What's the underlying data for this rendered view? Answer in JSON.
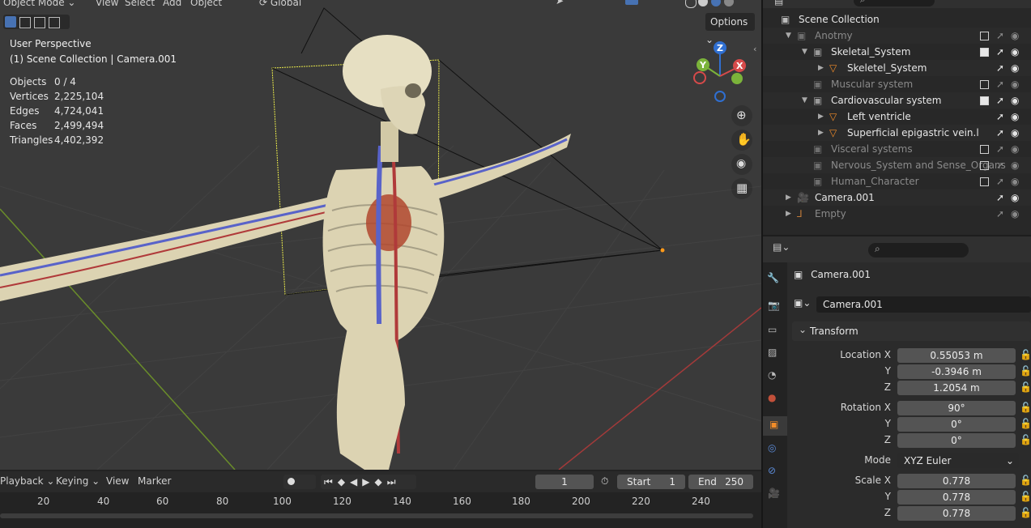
{
  "viewport": {
    "header": {
      "mode_label": "Object Mode",
      "menus": [
        "View",
        "Select",
        "Add",
        "Object"
      ],
      "orientation": "Global",
      "options_label": "Options"
    },
    "overlay": {
      "perspective": "User Perspective",
      "context": "(1) Scene Collection | Camera.001"
    },
    "stats": [
      {
        "label": "Objects",
        "value": "0 / 4"
      },
      {
        "label": "Vertices",
        "value": "2,225,104"
      },
      {
        "label": "Edges",
        "value": "4,724,041"
      },
      {
        "label": "Faces",
        "value": "2,499,494"
      },
      {
        "label": "Triangles",
        "value": "4,402,392"
      }
    ],
    "gizmo": {
      "z": "Z",
      "y": "Y",
      "x": "X"
    }
  },
  "timeline": {
    "menus": {
      "playback": "Playback",
      "keying": "Keying",
      "view": "View",
      "marker": "Marker"
    },
    "current_frame": "1",
    "start_label": "Start",
    "start_value": "1",
    "end_label": "End",
    "end_value": "250",
    "ruler": [
      "20",
      "40",
      "60",
      "80",
      "100",
      "120",
      "140",
      "160",
      "180",
      "200",
      "220",
      "240"
    ]
  },
  "outliner": {
    "root": "Scene Collection",
    "rows": [
      {
        "name": "Anotmy",
        "indent": 1,
        "expanded": true,
        "kind": "collection",
        "dim": true
      },
      {
        "name": "Skeletal_System",
        "indent": 2,
        "expanded": true,
        "kind": "collection",
        "dim": false
      },
      {
        "name": "Skeletel_System",
        "indent": 3,
        "expanded": false,
        "kind": "mesh",
        "dim": false
      },
      {
        "name": "Muscular system",
        "indent": 2,
        "expanded": null,
        "kind": "collection",
        "dim": true
      },
      {
        "name": "Cardiovascular system",
        "indent": 2,
        "expanded": true,
        "kind": "collection",
        "dim": false
      },
      {
        "name": "Left ventricle",
        "indent": 3,
        "expanded": false,
        "kind": "mesh",
        "dim": false
      },
      {
        "name": "Superficial epigastric vein.l",
        "indent": 3,
        "expanded": false,
        "kind": "mesh",
        "dim": false
      },
      {
        "name": "Visceral systems",
        "indent": 2,
        "expanded": null,
        "kind": "collection",
        "dim": true
      },
      {
        "name": "Nervous_System and Sense_Organs",
        "indent": 2,
        "expanded": null,
        "kind": "collection",
        "dim": true
      },
      {
        "name": "Human_Character",
        "indent": 2,
        "expanded": null,
        "kind": "collection",
        "dim": true
      },
      {
        "name": "Camera.001",
        "indent": 1,
        "expanded": false,
        "kind": "camera",
        "dim": false
      },
      {
        "name": "Empty",
        "indent": 1,
        "expanded": false,
        "kind": "empty",
        "dim": true
      }
    ]
  },
  "properties": {
    "object_name": "Camera.001",
    "object_field": "Camera.001",
    "panel": "Transform",
    "location": [
      {
        "label": "Location X",
        "value": "0.55053 m"
      },
      {
        "label": "Y",
        "value": "-0.3946 m"
      },
      {
        "label": "Z",
        "value": "1.2054 m"
      }
    ],
    "rotation": [
      {
        "label": "Rotation X",
        "value": "90°"
      },
      {
        "label": "Y",
        "value": "0°"
      },
      {
        "label": "Z",
        "value": "0°"
      }
    ],
    "mode_label": "Mode",
    "mode_value": "XYZ Euler",
    "scale": [
      {
        "label": "Scale X",
        "value": "0.778"
      },
      {
        "label": "Y",
        "value": "0.778"
      },
      {
        "label": "Z",
        "value": "0.778"
      }
    ]
  }
}
